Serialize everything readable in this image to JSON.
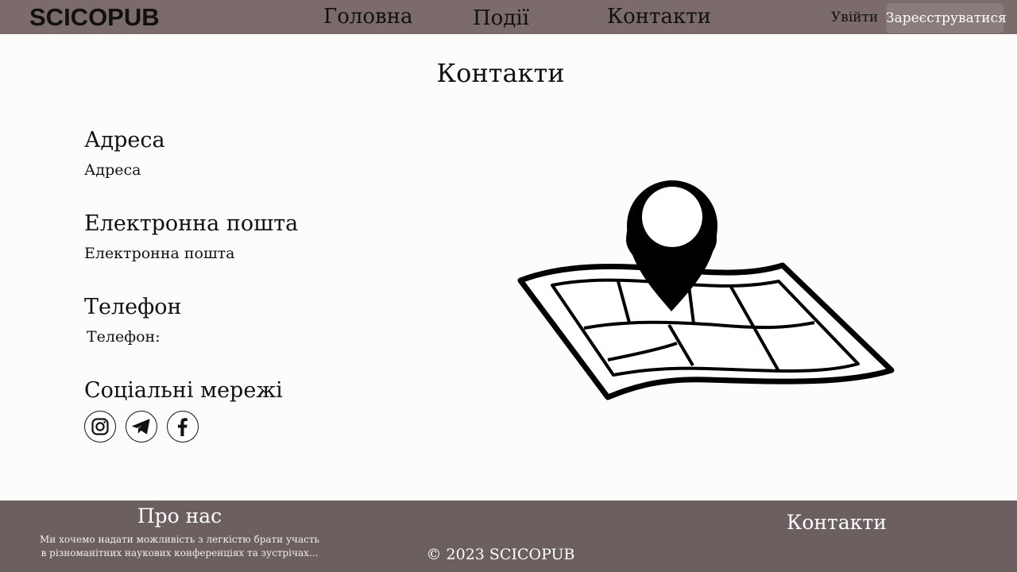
{
  "header": {
    "logo": "SCICOPUB",
    "nav": {
      "home": "Головна",
      "events": "Події",
      "contacts": "Контакти"
    },
    "login": "Увійти",
    "register": "Зареєструватися",
    "background_color": "#7b6b6b"
  },
  "main": {
    "title": "Контакти",
    "address": {
      "title": "Адреса",
      "value": "Адреса"
    },
    "email": {
      "title": "Електронна пошта",
      "value": "Електронна пошта"
    },
    "phone": {
      "title": "Телефон",
      "value": "Телефон:"
    },
    "social": {
      "title": "Соціальні мережі",
      "icons": [
        "instagram-icon",
        "telegram-icon",
        "facebook-icon"
      ]
    },
    "illustration": "map-pin-icon"
  },
  "footer": {
    "about_title": "Про нас",
    "about_text_line1": "Ми хочемо надати можливість з легкістю брати участь",
    "about_text_line2": "в різноманітних наукових конференціях та зустрічах...",
    "copyright": "© 2023 SCICOPUB",
    "contacts": "Контакти",
    "background_color": "#6b5f5f"
  }
}
